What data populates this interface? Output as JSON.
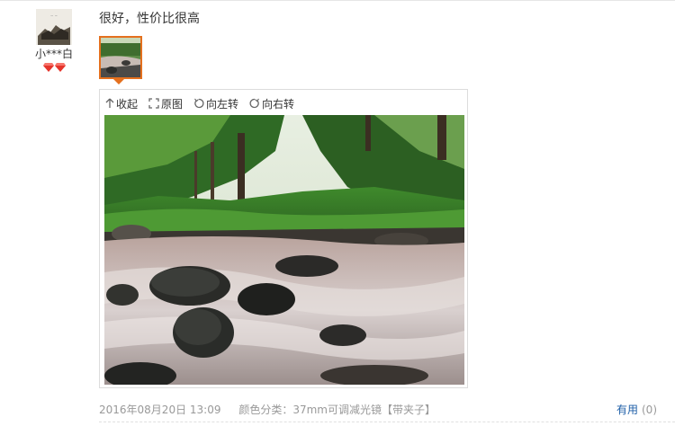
{
  "review": {
    "username": "小***白",
    "comment": "很好，性价比很高",
    "date": "2016年08月20日 13:09",
    "spec_label": "颜色分类：",
    "spec_value": "37mm可调减光镜【带夹子】",
    "useful_label": "有用",
    "useful_count": "(0)"
  },
  "toolbar": {
    "collapse": "收起",
    "original": "原图",
    "rotate_left": "向左转",
    "rotate_right": "向右转"
  },
  "icons": {
    "collapse": "collapse-arrow-icon",
    "original": "expand-icon",
    "rotate_left": "rotate-left-icon",
    "rotate_right": "rotate-right-icon",
    "vip": "red-diamond-icon"
  },
  "colors": {
    "thumb_border": "#e4701e",
    "link": "#1f5fa8",
    "meta": "#999999"
  }
}
